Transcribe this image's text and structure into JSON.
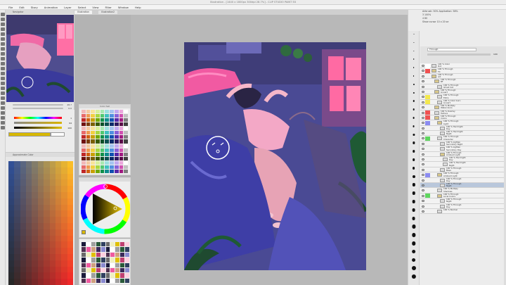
{
  "window": {
    "title": "Illustration - [1440 x 1800px 300dpi 28.7%] - CLIP STUDIO PAINT EX"
  },
  "menu": {
    "items": [
      "File",
      "Edit",
      "Story",
      "Animation",
      "Layer",
      "Select",
      "View",
      "Filter",
      "Window",
      "Help"
    ]
  },
  "doc_tabs": [
    "Illustration",
    "Illustration2"
  ],
  "navigator": {
    "title": "Navigator",
    "zoom_value": "28.7",
    "rotate_value": "0.0"
  },
  "color_sliders": {
    "rows": [
      {
        "value": "1"
      },
      {
        "value": "94"
      },
      {
        "value": "100"
      }
    ]
  },
  "mixer": {
    "title": "Approximate Color"
  },
  "swatches": {
    "title": "Color Set"
  },
  "tool_property": {
    "title": "Airbrush: 50%  Application: 58%",
    "lines": [
      "3  100%",
      "4  80",
      "Show cursor  10 x 20 se"
    ]
  },
  "layer_panel": {
    "blend_mode": "Through",
    "opacity": "100",
    "layers": [
      {
        "label": "100 % Color",
        "sub": "Dot",
        "tag": "#ffffff",
        "indent": 0,
        "thumb": true
      },
      {
        "label": "100 % Through",
        "sub": "FX",
        "tag": "#f05050",
        "indent": 0,
        "thumb": false
      },
      {
        "label": "100 % Through",
        "sub": "Art",
        "tag": "",
        "indent": 0,
        "thumb": false
      },
      {
        "label": "100 % Through",
        "sub": "BF",
        "tag": "",
        "indent": 1,
        "thumb": false
      },
      {
        "label": "100 % Through",
        "sub": "Ghost Cat",
        "tag": "",
        "indent": 2,
        "thumb": true
      },
      {
        "label": "100 % Through",
        "sub": "Lineart",
        "tag": "",
        "indent": 1,
        "thumb": false
      },
      {
        "label": "100 % Through",
        "sub": "Extra",
        "tag": "#f3e84d",
        "indent": 2,
        "thumb": true
      },
      {
        "label": "100 % Color burn",
        "sub": "Lineart",
        "tag": "#f3e84d",
        "indent": 2,
        "thumb": true
      },
      {
        "label": "100 % Multiply",
        "sub": "Watercolors",
        "tag": "",
        "indent": 1,
        "thumb": false
      },
      {
        "label": "100 % Overlay",
        "sub": "Texture",
        "tag": "#f05050",
        "indent": 1,
        "thumb": true
      },
      {
        "label": "100 % Through",
        "sub": "Colors",
        "tag": "#f05050",
        "indent": 1,
        "thumb": false
      },
      {
        "label": "100 % Through",
        "sub": "Light",
        "tag": "#8b8bf0",
        "indent": 2,
        "thumb": false
      },
      {
        "label": "100 % Hard light",
        "sub": "Day",
        "tag": "",
        "indent": 3,
        "thumb": true
      },
      {
        "label": "100 % Hard light",
        "sub": "Night",
        "tag": "",
        "indent": 3,
        "thumb": true
      },
      {
        "label": "100 % Through",
        "sub": "Character",
        "tag": "#5ed65e",
        "indent": 2,
        "thumb": true
      },
      {
        "label": "100 % Lighten",
        "sub": "Secondary Night",
        "tag": "",
        "indent": 3,
        "thumb": true
      },
      {
        "label": "100 % Lighten",
        "sub": "Secondary Day",
        "tag": "",
        "indent": 3,
        "thumb": true
      },
      {
        "label": "100 % Through",
        "sub": "Ambient Light",
        "tag": "",
        "indent": 3,
        "thumb": false
      },
      {
        "label": "100 % Hard light",
        "sub": "Day",
        "tag": "",
        "indent": 4,
        "thumb": true
      },
      {
        "label": "100 % Hard light",
        "sub": "Night",
        "tag": "",
        "indent": 4,
        "thumb": true
      },
      {
        "label": "100 % Through",
        "sub": "Base",
        "tag": "",
        "indent": 3,
        "thumb": true
      },
      {
        "label": "100 % Through",
        "sub": "Ambient Light",
        "tag": "#8b8bf0",
        "indent": 2,
        "thumb": false
      },
      {
        "label": "100 % Through",
        "sub": "Day",
        "tag": "",
        "indent": 3,
        "thumb": true
      },
      {
        "label": "100 % Through",
        "sub": "Night",
        "tag": "",
        "indent": 3,
        "thumb": true,
        "selected": true
      },
      {
        "label": "100 % Multiply",
        "sub": "Shadows",
        "tag": "",
        "indent": 2,
        "thumb": true
      },
      {
        "label": "100 % Through",
        "sub": "Local Colors",
        "tag": "#5ed65e",
        "indent": 2,
        "thumb": false
      },
      {
        "label": "100 % Through",
        "sub": "Night",
        "tag": "",
        "indent": 3,
        "thumb": true
      },
      {
        "label": "100 % Through",
        "sub": "Day",
        "tag": "",
        "indent": 3,
        "thumb": true
      },
      {
        "label": "100 % Normal",
        "sub": "",
        "tag": "",
        "indent": 2,
        "thumb": true
      }
    ]
  }
}
